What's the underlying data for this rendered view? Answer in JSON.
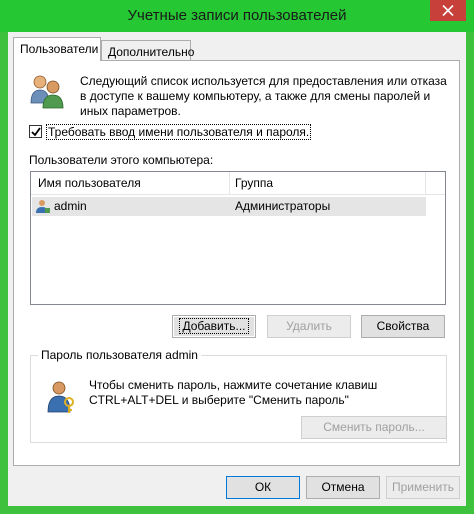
{
  "window": {
    "title": "Учетные записи пользователей"
  },
  "tabs": [
    {
      "label": "Пользователи",
      "active": true
    },
    {
      "label": "Дополнительно",
      "active": false
    }
  ],
  "info_text": "Следующий список используется для предоставления или отказа в доступе к вашему компьютеру, а также для смены паролей и иных параметров.",
  "require_login": {
    "label": "Требовать ввод имени пользователя и пароля.",
    "checked": true
  },
  "users_list": {
    "label": "Пользователи этого компьютера:",
    "columns": [
      "Имя пользователя",
      "Группа"
    ],
    "rows": [
      {
        "name": "admin",
        "group": "Администраторы"
      }
    ]
  },
  "buttons": {
    "add": "Добавить...",
    "delete": "Удалить",
    "properties": "Свойства",
    "change_password": "Сменить пароль...",
    "ok": "ОК",
    "cancel": "Отмена",
    "apply": "Применить"
  },
  "password_group": {
    "title": "Пароль пользователя admin",
    "text": "Чтобы сменить пароль, нажмите сочетание клавиш CTRL+ALT+DEL и выберите \"Сменить пароль\""
  },
  "colors": {
    "titlebar": "#25c733",
    "close": "#c7403a",
    "selection": "#e5e5e5"
  }
}
